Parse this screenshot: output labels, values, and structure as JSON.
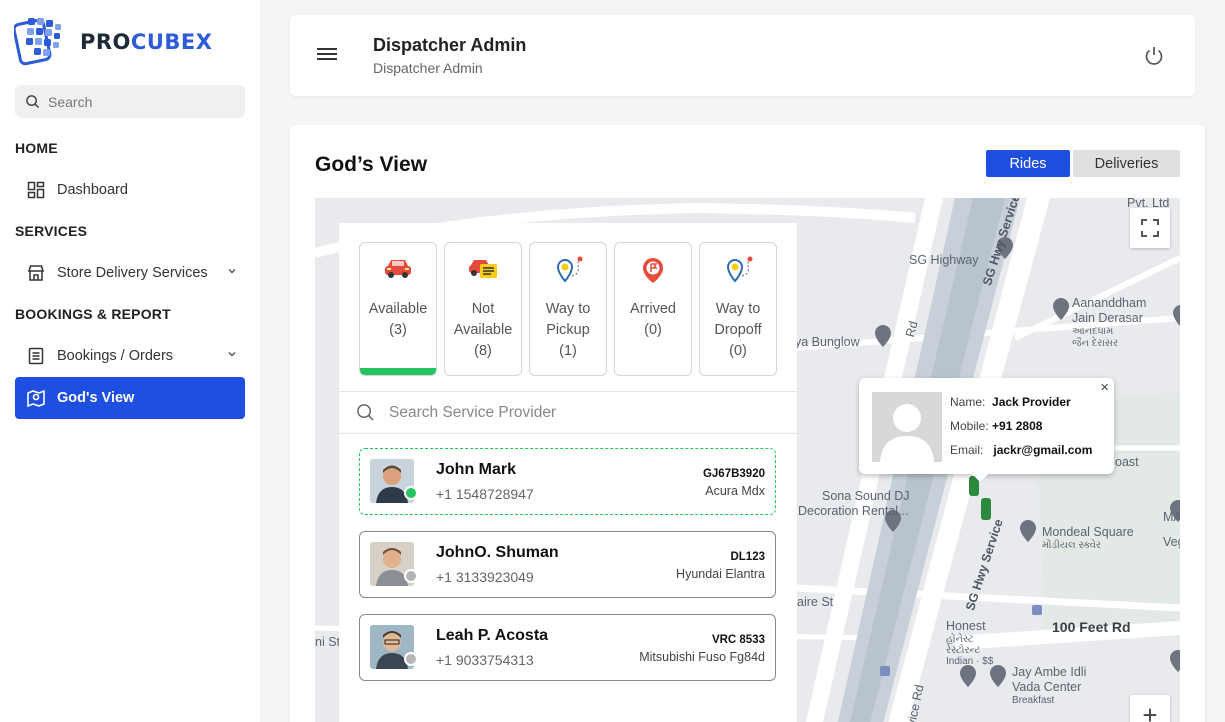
{
  "brand": {
    "name_part1": "PRO",
    "name_part2": "CUBEX"
  },
  "sidebar": {
    "search_placeholder": "Search",
    "sections": [
      {
        "title": "HOME",
        "items": [
          {
            "label": "Dashboard",
            "icon": "dashboard-grid-icon"
          }
        ]
      },
      {
        "title": "SERVICES",
        "items": [
          {
            "label": "Store Delivery Services",
            "icon": "store-icon",
            "has_chevron": true
          }
        ]
      },
      {
        "title": "BOOKINGS & REPORT",
        "items": [
          {
            "label": "Bookings / Orders",
            "icon": "list-document-icon",
            "has_chevron": true
          },
          {
            "label": "God's View",
            "icon": "map-pin-icon",
            "active": true
          }
        ]
      }
    ]
  },
  "header": {
    "title": "Dispatcher Admin",
    "subtitle": "Dispatcher Admin"
  },
  "page": {
    "title": "God’s View",
    "toggle": {
      "rides": "Rides",
      "deliveries": "Deliveries",
      "selected": "Rides"
    }
  },
  "status_filters": [
    {
      "label1": "Available",
      "label2": "(3)",
      "icon": "car-red-icon",
      "active": true
    },
    {
      "label1": "Not",
      "label2": "Available",
      "label3": "(8)",
      "icon": "car-unavailable-icon"
    },
    {
      "label1": "Way to",
      "label2": "Pickup",
      "label3": "(1)",
      "icon": "route-pickup-icon"
    },
    {
      "label1": "Arrived",
      "label2": "(0)",
      "icon": "flag-pin-icon"
    },
    {
      "label1": "Way to",
      "label2": "Dropoff",
      "label3": "(0)",
      "icon": "route-dropoff-icon"
    }
  ],
  "provider_search_placeholder": "Search Service Provider",
  "providers": [
    {
      "name": "John Mark",
      "phone": "+1 1548728947",
      "plate": "GJ67B3920",
      "car": "Acura Mdx",
      "status": "online"
    },
    {
      "name": "JohnO. Shuman",
      "phone": "+1 3133923049",
      "plate": "DL123",
      "car": "Hyundai Elantra",
      "status": "offline"
    },
    {
      "name": "Leah P. Acosta",
      "phone": "+1 9033754313",
      "plate": "VRC 8533",
      "car": "Mitsubishi Fuso Fg84d",
      "status": "offline"
    }
  ],
  "popup": {
    "name_label": "Name:",
    "name": "Jack Provider",
    "mobile_label": "Mobile:",
    "mobile": "+91 2808",
    "email_label": "Email:",
    "email": "jackr@gmail.com",
    "close": "×"
  },
  "map": {
    "labels": {
      "pvt": "Pvt. Ltd",
      "sg_highway": "SG Highway",
      "sg_service_rd": "SG Hwy Service Rd",
      "bunglow": "ya Bunglow",
      "aananddham1": "Aananddham",
      "aananddham2": "Jain Derasar",
      "aananddham3": "આનંદધામ",
      "aananddham4": "જૈન દેરાસર",
      "oast": "oast",
      "sona1": "Sona Sound DJ",
      "sona2": "Decoration Rental...",
      "mondeal1": "Mondeal Square",
      "mondeal2": "મોંડીયલ સ્ક્વેર",
      "mad": "MAD",
      "vege": "Vege",
      "aire_st": "aire St",
      "sg_service_rd2": "SG Hwy Service",
      "honest1": "Honest",
      "honest2": "હોનેસ્ટ",
      "honest3": "રેસ્ટોરન્ટ",
      "honest4": "Indian · $$",
      "feet_rd": "100 Feet Rd",
      "jay1": "Jay Ambe Idli",
      "jay2": "Vada Center",
      "jay3": "Breakfast",
      "ni_st": "ni St",
      "service_rd3": "ervice Rd",
      "rd": "Rd"
    },
    "zoom_in": "+"
  }
}
